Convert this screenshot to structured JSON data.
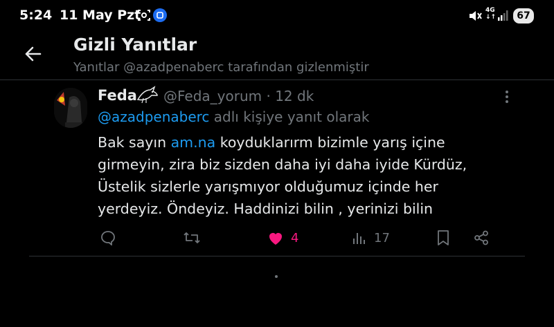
{
  "status_bar": {
    "time": "5:24",
    "date": "11 May Pzt",
    "network_top": "4G",
    "network_bottom": "↓↑",
    "battery": "67"
  },
  "header": {
    "title": "Gizli Yanıtlar",
    "subtitle": "Yanıtlar @azadpenaberc tarafından gizlenmiştir"
  },
  "tweet": {
    "author_name": "Feda",
    "author_emoji": "🐦‍⬛",
    "handle_time": "@Feda_yorum · 12 dk",
    "reply_mention": "@azadpenaberc",
    "reply_suffix": " adlı kişiye yanıt olarak",
    "text_before_link": "Bak sayın ",
    "link_text": "am.na",
    "text_after_link": " koyduklarırm bizimle yarış içine girmeyin, zira biz sizden daha iyi daha iyide Kürdüz, Üstelik sizlerle yarışmıyor olduğumuz içinde her yerdeyiz. Öndeyiz. Haddinizi bilin , yerinizi bilin",
    "likes": "4",
    "views": "17"
  },
  "colors": {
    "accent": "#1d9bf0",
    "like": "#f91880",
    "muted": "#71767b",
    "background": "#000000"
  }
}
